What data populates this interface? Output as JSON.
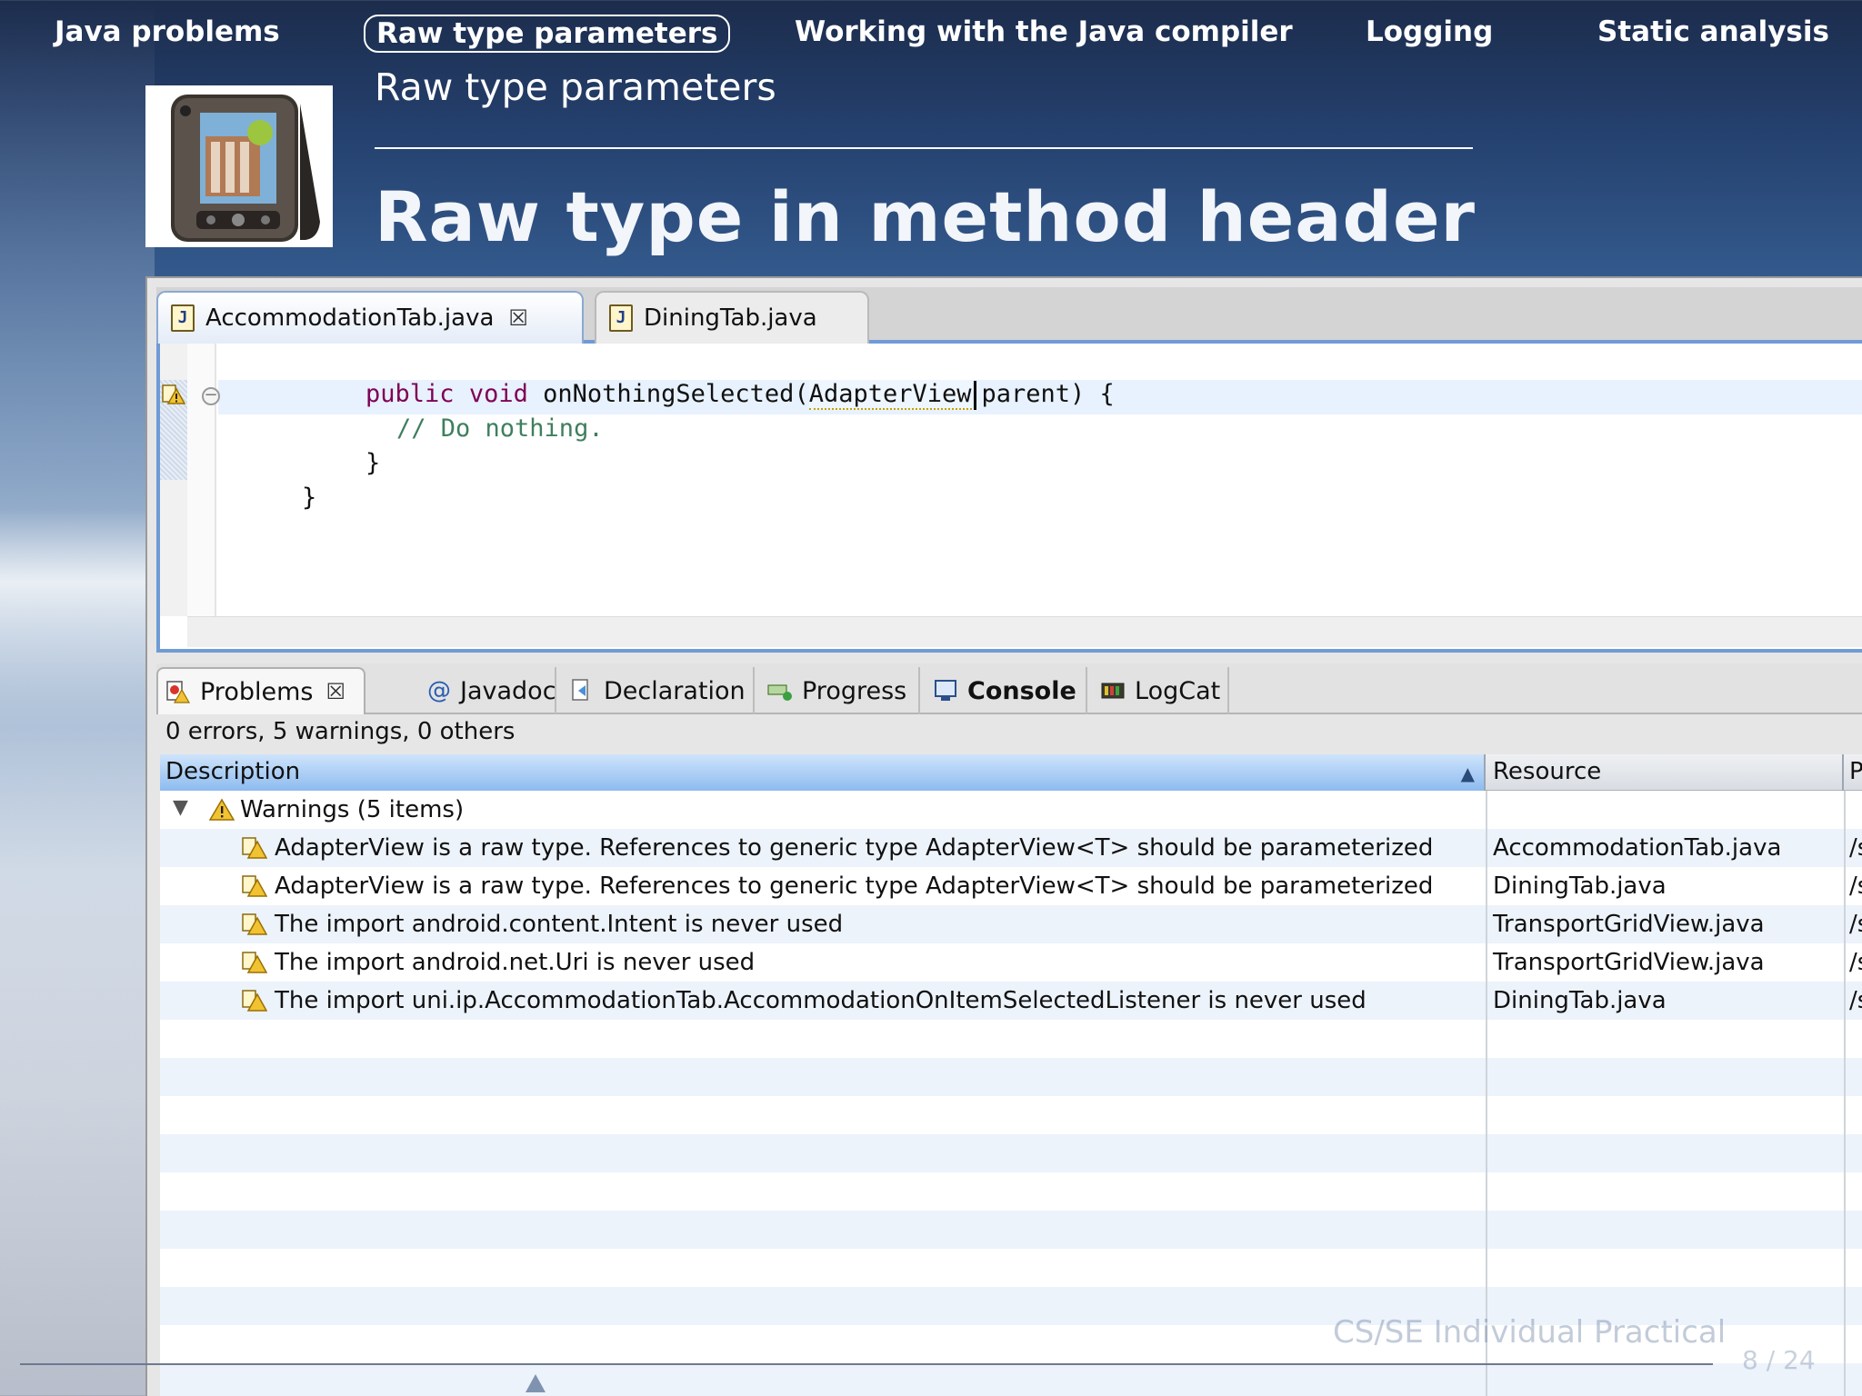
{
  "nav": {
    "items": [
      {
        "label": "Java problems"
      },
      {
        "label": "Raw type parameters"
      },
      {
        "label": "Working with the Java compiler"
      },
      {
        "label": "Logging"
      },
      {
        "label": "Static analysis"
      }
    ]
  },
  "header": {
    "section_title": "Raw type parameters",
    "slide_title": "Raw type in method header"
  },
  "editor": {
    "tabs": [
      {
        "label": "AccommodationTab.java",
        "close": "☒"
      },
      {
        "label": "DiningTab.java"
      }
    ],
    "code": {
      "line1_indent": "      ",
      "kw_public": "public",
      "kw_void": "void",
      "method": " onNothingSelected(",
      "raw_type": "AdapterView",
      "after_raw": "parent) {",
      "comment": "// Do nothing.",
      "brace_inner": "}",
      "brace_outer": "}"
    }
  },
  "views": {
    "tabs": [
      {
        "label": "Problems",
        "close": "☒"
      },
      {
        "label": "Javadoc",
        "icon_glyph": "@"
      },
      {
        "label": "Declaration"
      },
      {
        "label": "Progress"
      },
      {
        "label": "Console"
      },
      {
        "label": "LogCat"
      }
    ],
    "summary": "0 errors, 5 warnings, 0 others",
    "columns": {
      "description": "Description",
      "resource": "Resource",
      "path": "Pa"
    },
    "group": {
      "toggle": "▼",
      "label": "Warnings (5 items)"
    },
    "rows": [
      {
        "description": "AdapterView is a raw type. References to generic type AdapterView<T> should be parameterized",
        "resource": "AccommodationTab.java",
        "path": "/s"
      },
      {
        "description": "AdapterView is a raw type. References to generic type AdapterView<T> should be parameterized",
        "resource": "DiningTab.java",
        "path": "/s"
      },
      {
        "description": "The import android.content.Intent is never used",
        "resource": "TransportGridView.java",
        "path": "/s"
      },
      {
        "description": "The import android.net.Uri is never used",
        "resource": "TransportGridView.java",
        "path": "/s"
      },
      {
        "description": "The import uni.ip.AccommodationTab.AccommodationOnItemSelectedListener is never used",
        "resource": "DiningTab.java",
        "path": "/s"
      }
    ]
  },
  "footer": {
    "course": "CS/SE Individual Practical",
    "page": "8 / 24"
  },
  "colors": {
    "keyword": "#7f0055",
    "comment": "#3f7f5f",
    "selection_header": "#8dbbef",
    "warning": "#e8b400"
  }
}
